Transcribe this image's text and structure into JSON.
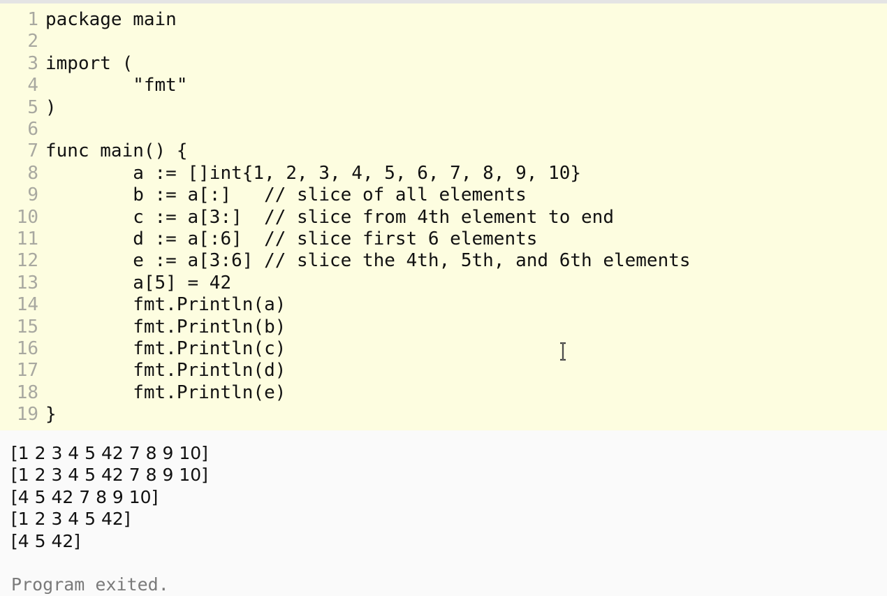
{
  "editor": {
    "lines": [
      {
        "num": "1",
        "text": "package main"
      },
      {
        "num": "2",
        "text": ""
      },
      {
        "num": "3",
        "text": "import ("
      },
      {
        "num": "4",
        "text": "        \"fmt\""
      },
      {
        "num": "5",
        "text": ")"
      },
      {
        "num": "6",
        "text": ""
      },
      {
        "num": "7",
        "text": "func main() {"
      },
      {
        "num": "8",
        "text": "        a := []int{1, 2, 3, 4, 5, 6, 7, 8, 9, 10}"
      },
      {
        "num": "9",
        "text": "        b := a[:]   // slice of all elements"
      },
      {
        "num": "10",
        "text": "        c := a[3:]  // slice from 4th element to end"
      },
      {
        "num": "11",
        "text": "        d := a[:6]  // slice first 6 elements"
      },
      {
        "num": "12",
        "text": "        e := a[3:6] // slice the 4th, 5th, and 6th elements"
      },
      {
        "num": "13",
        "text": "        a[5] = 42"
      },
      {
        "num": "14",
        "text": "        fmt.Println(a)"
      },
      {
        "num": "15",
        "text": "        fmt.Println(b)"
      },
      {
        "num": "16",
        "text": "        fmt.Println(c)"
      },
      {
        "num": "17",
        "text": "        fmt.Println(d)"
      },
      {
        "num": "18",
        "text": "        fmt.Println(e)"
      },
      {
        "num": "19",
        "text": "}"
      }
    ]
  },
  "output": {
    "lines": [
      "[1 2 3 4 5 42 7 8 9 10]",
      "[1 2 3 4 5 42 7 8 9 10]",
      "[4 5 42 7 8 9 10]",
      "[1 2 3 4 5 42]",
      "[4 5 42]"
    ],
    "status": "Program exited."
  },
  "colors": {
    "editor_bg": "#fdfde0",
    "output_bg": "#fafafa",
    "line_number": "#a8a8a0",
    "status_text": "#7a7a7a"
  },
  "icons": {
    "cursor": "i-beam-cursor-icon"
  }
}
